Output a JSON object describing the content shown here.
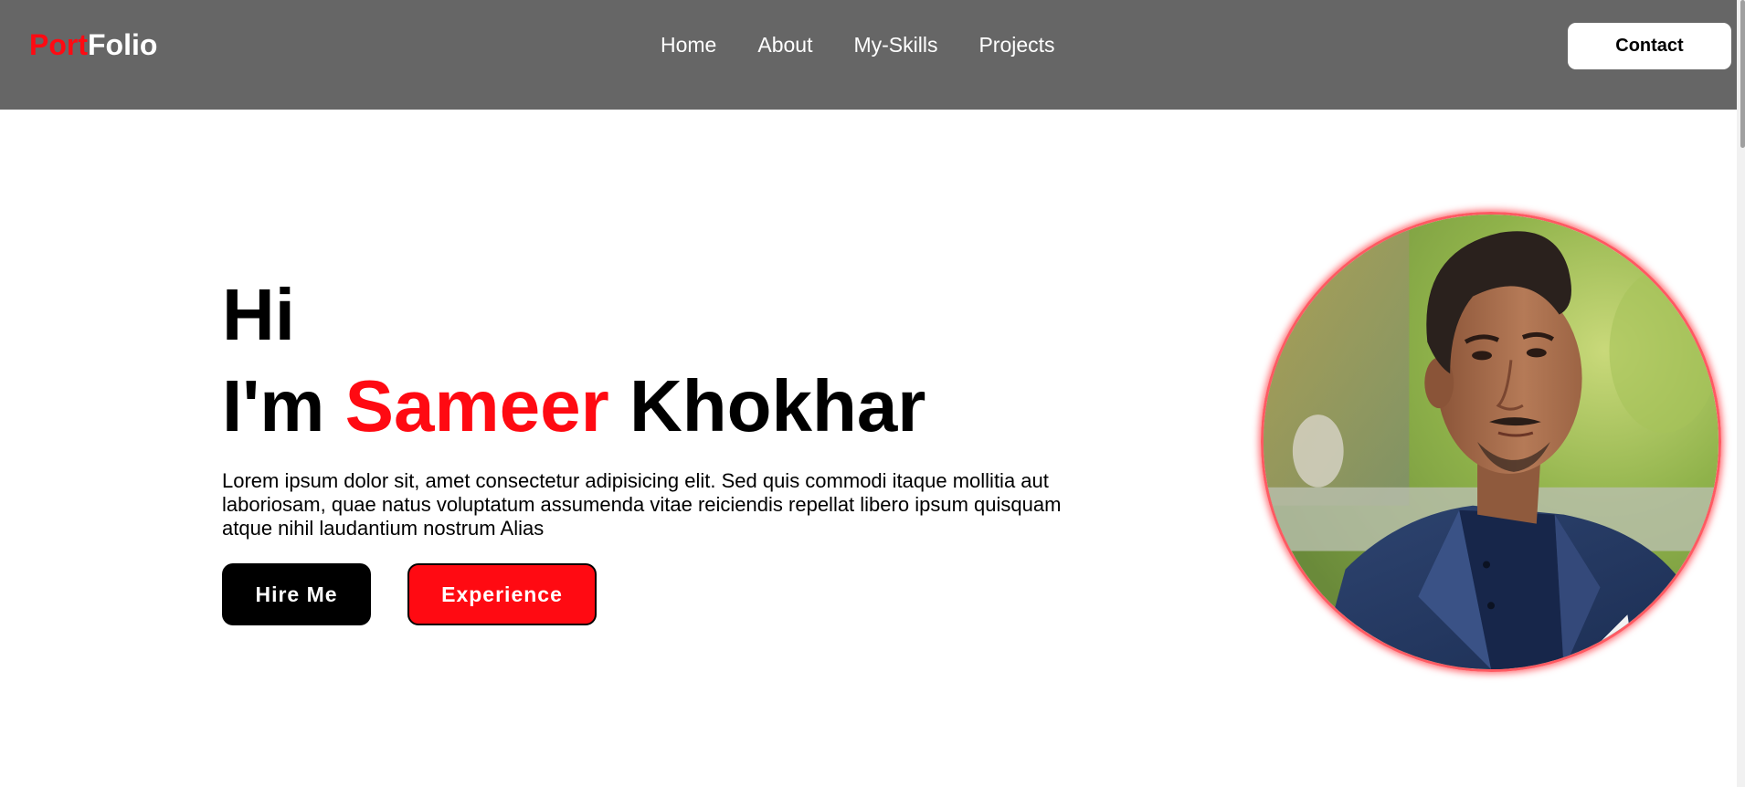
{
  "navbar": {
    "logo_part1": "Port",
    "logo_part2": "Folio",
    "links": [
      {
        "label": "Home"
      },
      {
        "label": "About"
      },
      {
        "label": "My-Skills"
      },
      {
        "label": "Projects"
      }
    ],
    "contact_label": "Contact"
  },
  "hero": {
    "greeting": "Hi",
    "intro_prefix": "I'm ",
    "name_first": "Sameer",
    "name_last": " Khokhar",
    "description": "Lorem ipsum dolor sit, amet consectetur adipisicing elit. Sed quis commodi itaque mollitia aut laboriosam, quae natus voluptatum assumenda vitae reiciendis repellat libero ipsum quisquam atque nihil laudantium nostrum Alias",
    "hire_label": "Hire Me",
    "experience_label": "Experience"
  },
  "colors": {
    "accent": "#ff0a12",
    "navbar_bg": "#666666",
    "text": "#000000",
    "background": "#ffffff"
  }
}
